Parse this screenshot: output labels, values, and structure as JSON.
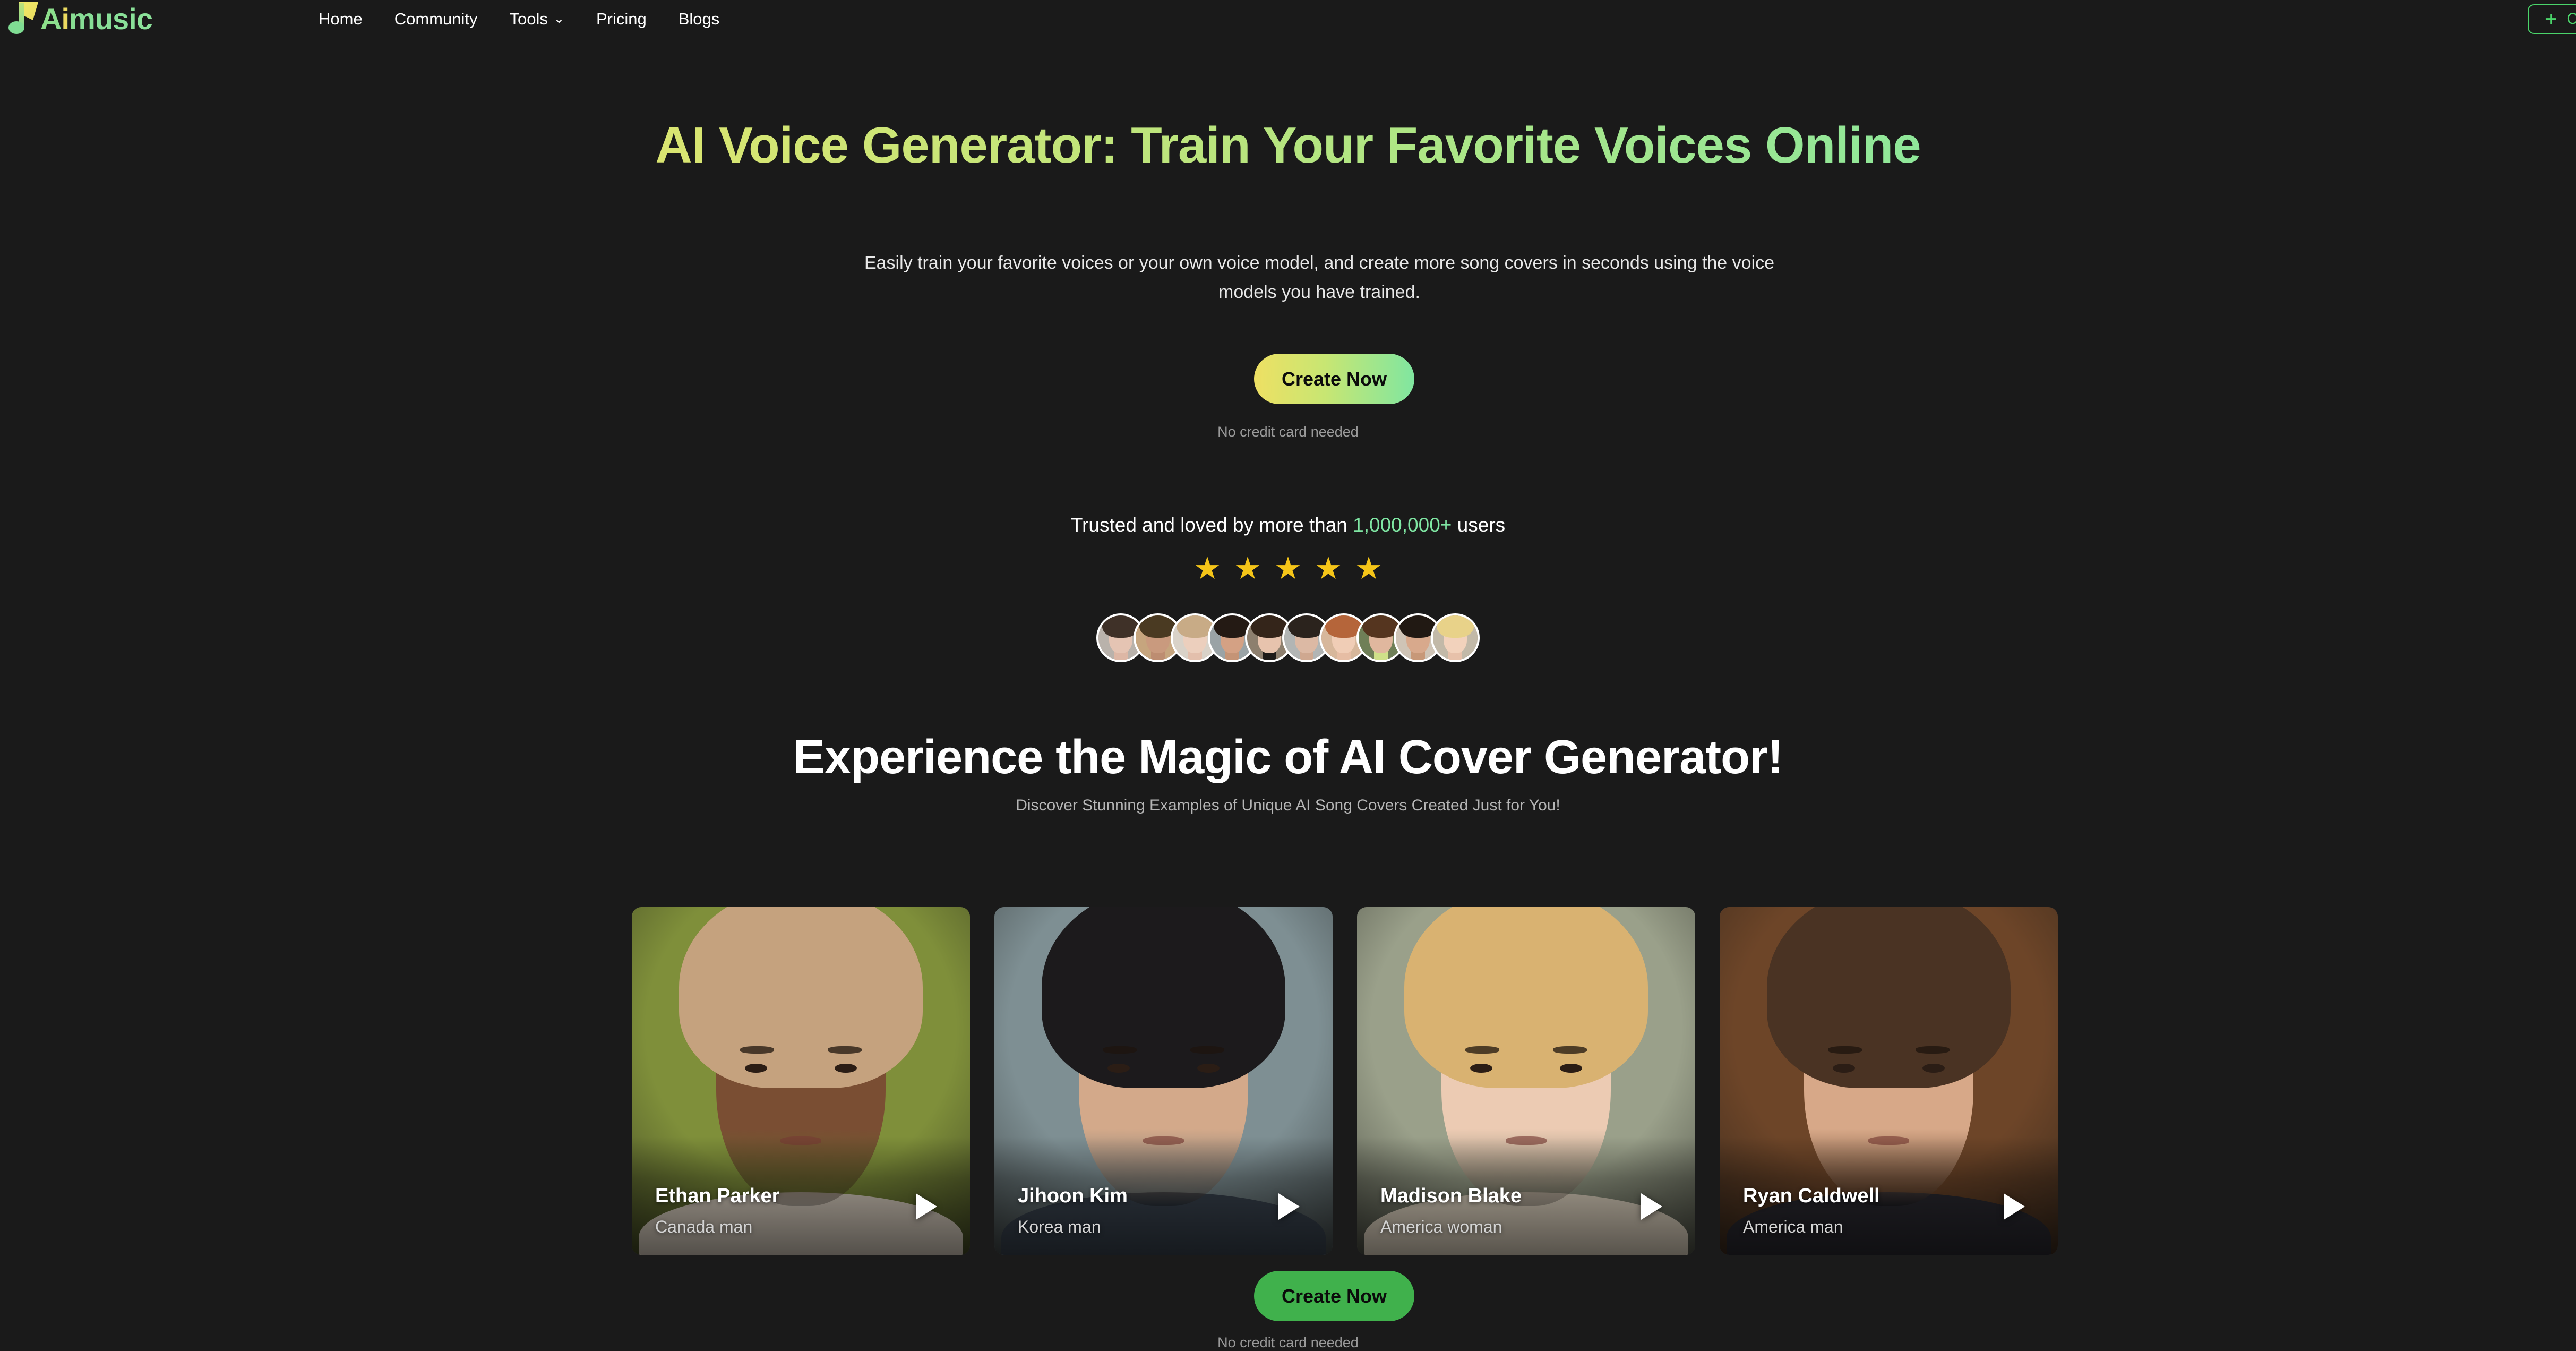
{
  "brand": {
    "name": "Aimusic",
    "logo_icon": "music-note-icon",
    "logo_colors": {
      "note_green": "#7fdd93",
      "note_yellow": "#ecd95f"
    }
  },
  "header": {
    "nav": [
      {
        "label": "Home",
        "has_dropdown": false
      },
      {
        "label": "Community",
        "has_dropdown": false
      },
      {
        "label": "Tools",
        "has_dropdown": true,
        "chevron": "⌄"
      },
      {
        "label": "Pricing",
        "has_dropdown": false
      },
      {
        "label": "Blogs",
        "has_dropdown": false
      }
    ],
    "cta": {
      "plus_icon": "plus-icon",
      "plus_glyph": "+",
      "label": "Cr",
      "accent": "#4ad46a"
    }
  },
  "hero": {
    "title": "AI Voice Generator: Train Your Favorite Voices Online",
    "subtitle": "Easily train your favorite voices or your own voice model, and create more song covers in seconds using the voice models you have trained.",
    "cta_label": "Create Now",
    "cta_note": "No credit card needed",
    "gradient_from": "#ece063",
    "gradient_to": "#7fe6a3"
  },
  "trust": {
    "prefix": "Trusted and loved by more than ",
    "count": "1,000,000+",
    "suffix": " users",
    "count_color": "#7fe6a3",
    "stars": 5,
    "star_glyph": "★",
    "star_color": "#f5c518",
    "avatars": [
      {
        "name": "avatar-1",
        "bg": "#b9b2ab",
        "hair": "#3f3128",
        "skin": "#e5c4b3",
        "neck": "#ddb7a5"
      },
      {
        "name": "avatar-2",
        "bg": "#c6a57e",
        "hair": "#4a3a22",
        "skin": "#c99a7e",
        "neck": "#bd8d71"
      },
      {
        "name": "avatar-3",
        "bg": "#d9d2c8",
        "hair": "#c8ab86",
        "skin": "#eccfbd",
        "neck": "#e3bfac"
      },
      {
        "name": "avatar-4",
        "bg": "#9aa3a6",
        "hair": "#241a14",
        "skin": "#d4a184",
        "neck": "#c59476"
      },
      {
        "name": "avatar-5",
        "bg": "#8d7f6e",
        "hair": "#34251a",
        "skin": "#e7c3ad",
        "neck": "#1d1a18"
      },
      {
        "name": "avatar-6",
        "bg": "#b2b5b4",
        "hair": "#2b231d",
        "skin": "#dcb9a4",
        "neck": "#cfa890"
      },
      {
        "name": "avatar-7",
        "bg": "#d7b79b",
        "hair": "#b5653a",
        "skin": "#f0cdb6",
        "neck": "#e6bda4"
      },
      {
        "name": "avatar-8",
        "bg": "#6f7f57",
        "hair": "#55351f",
        "skin": "#e0b79e",
        "neck": "#cfe089"
      },
      {
        "name": "avatar-9",
        "bg": "#cfc4b6",
        "hair": "#211913",
        "skin": "#d8a98c",
        "neck": "#c79878"
      },
      {
        "name": "avatar-10",
        "bg": "#c2b9a8",
        "hair": "#e8d289",
        "skin": "#f2d2bc",
        "neck": "#e7c1aa"
      }
    ]
  },
  "showcase": {
    "title": "Experience the Magic of AI Cover Generator!",
    "subtitle": "Discover Stunning Examples of Unique AI Song Covers Created Just for You!",
    "cards": [
      {
        "name": "Ethan Parker",
        "description": "Canada man",
        "play_icon": "play-icon",
        "palette": {
          "bg": "#7f8f3a",
          "hair": "#c5a27e",
          "skin": "#7a4e33",
          "shoulders": "#ded3c4"
        }
      },
      {
        "name": "Jihoon Kim",
        "description": "Korea man",
        "play_icon": "play-icon",
        "palette": {
          "bg": "#7e8f93",
          "hair": "#1c1a1c",
          "skin": "#d3a98a",
          "shoulders": "#3a4450"
        }
      },
      {
        "name": "Madison Blake",
        "description": "America woman",
        "play_icon": "play-icon",
        "palette": {
          "bg": "#9aa08a",
          "hair": "#d9b271",
          "skin": "#eccbb3",
          "shoulders": "#e8dcc8"
        }
      },
      {
        "name": "Ryan Caldwell",
        "description": "America man",
        "play_icon": "play-icon",
        "palette": {
          "bg": "#6d4528",
          "hair": "#4a3323",
          "skin": "#d7a888",
          "shoulders": "#2b2a31"
        }
      }
    ],
    "cta_label": "Create Now",
    "cta_note": "No credit card needed",
    "cta_color": "#40b14c"
  },
  "theme": {
    "background": "#1a1a1a",
    "text": "#ffffff",
    "muted": "#9a9a9a"
  }
}
